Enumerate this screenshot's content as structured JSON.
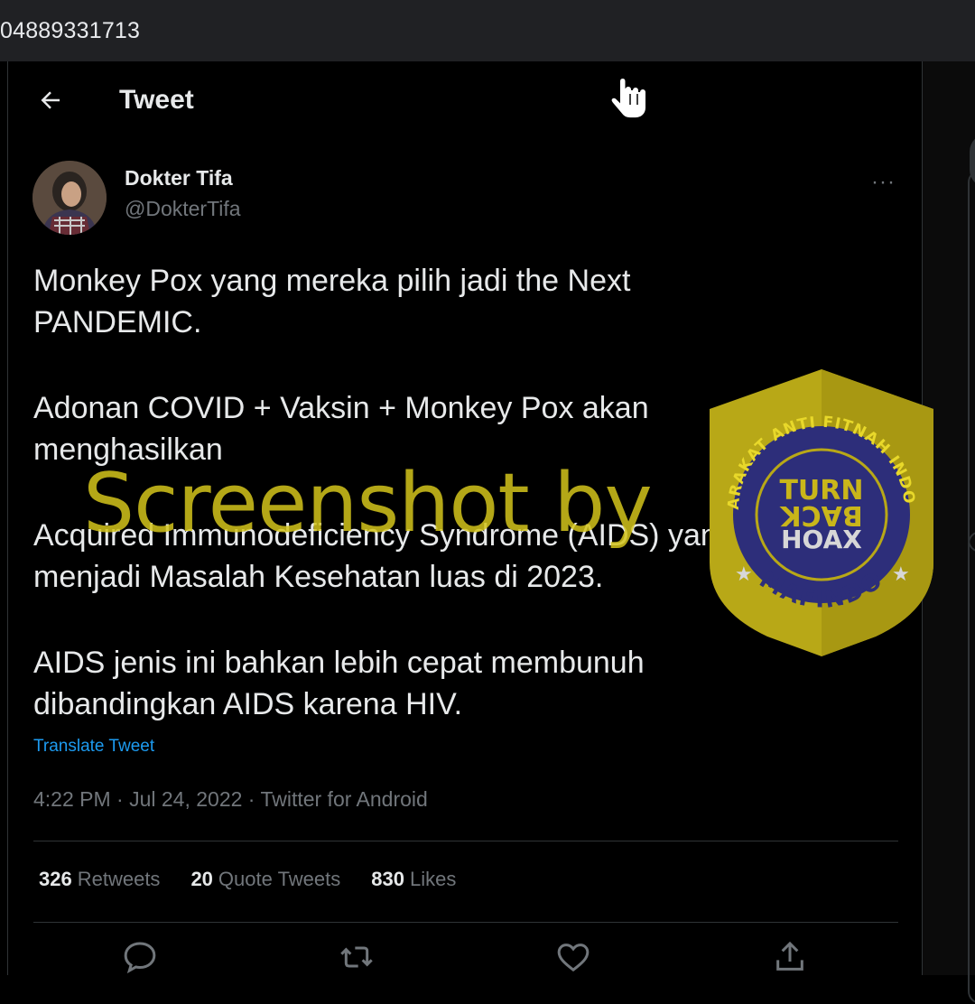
{
  "browser": {
    "url": "04889331713"
  },
  "header": {
    "title": "Tweet"
  },
  "tweet": {
    "author_name": "Dokter Tifa",
    "author_handle": "@DokterTifa",
    "more_label": "···",
    "paragraphs": [
      "Monkey Pox yang mereka pilih jadi the Next PANDEMIC.",
      "Adonan COVID + Vaksin + Monkey Pox akan menghasilkan",
      "Acquired Immunodeficiency Syndrome (AIDS) yang menjadi Masalah Kesehatan luas di 2023.",
      "AIDS jenis ini bahkan lebih cepat membunuh dibandingkan AIDS karena HIV."
    ],
    "translate_label": "Translate Tweet",
    "timestamp": "4:22 PM · Jul 24, 2022 · Twitter for Android",
    "stats": {
      "retweets_count": "326",
      "retweets_label": "Retweets",
      "quotes_count": "20",
      "quotes_label": "Quote Tweets",
      "likes_count": "830",
      "likes_label": "Likes"
    }
  },
  "overlay": {
    "watermark": "Screenshot by",
    "logo": {
      "ring_text": "MASYARAKAT ANTI FITNAH INDONESIA",
      "center_line1": "TURN",
      "center_line2": "BACK",
      "center_line3": "HOAX",
      "bottom_text": "MAFINDO"
    }
  },
  "colors": {
    "background": "#000000",
    "text": "#e7e9ea",
    "muted": "#71767b",
    "link": "#1d9bf0",
    "watermark": "#d4c51c",
    "logo_navy": "#2d2e7a"
  },
  "icons": [
    "back-arrow-icon",
    "hand-cursor-icon",
    "more-icon",
    "reply-icon",
    "retweet-icon",
    "like-icon",
    "share-icon"
  ]
}
